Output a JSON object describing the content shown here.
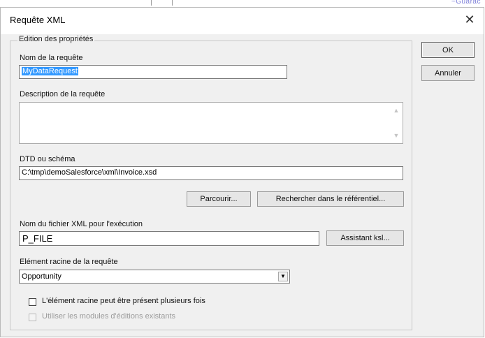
{
  "background": {
    "overflow_text": "~Guarac"
  },
  "dialog": {
    "title": "Requête XML",
    "close_glyph": "✕"
  },
  "group": {
    "legend": "Edition des propriétés"
  },
  "fields": {
    "request_name_label": "Nom de la requête",
    "request_name_value": "MyDataRequest",
    "description_label": "Description de la requête",
    "description_value": "",
    "schema_label": "DTD ou schéma",
    "schema_value": "C:\\tmp\\demoSalesforce\\xml\\Invoice.xsd",
    "xml_file_label": "Nom du fichier XML pour l'exécution",
    "xml_file_value": "P_FILE",
    "root_element_label": "Elément racine de la requête",
    "root_element_value": "Opportunity"
  },
  "buttons": {
    "ok": "OK",
    "cancel": "Annuler",
    "browse": "Parcourir...",
    "search_repository": "Rechercher dans le référentiel...",
    "xsl_wizard": "Assistant ksl..."
  },
  "checkboxes": {
    "multiple_root": "L'élément racine peut être présent plusieurs fois",
    "existing_modules": "Utiliser les modules d'éditions existants"
  },
  "scroll": {
    "up": "▲",
    "down": "▼"
  },
  "combo_arrow": "▼"
}
